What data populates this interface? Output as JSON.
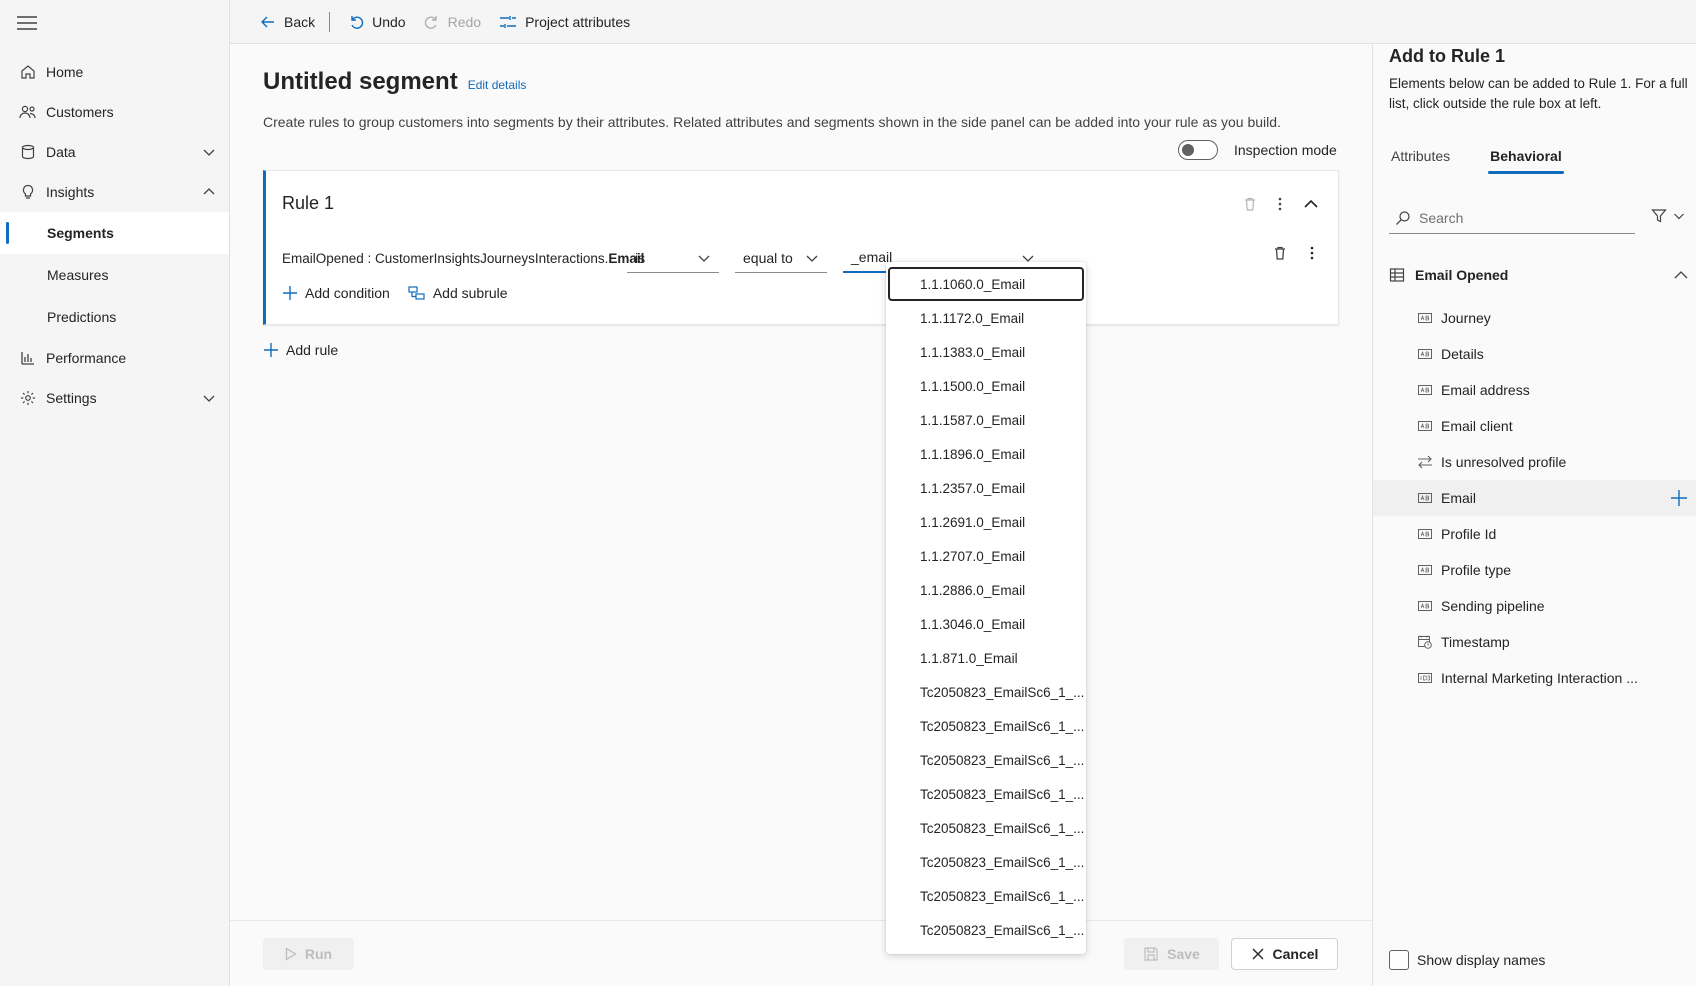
{
  "nav": {
    "items": [
      {
        "label": "Home"
      },
      {
        "label": "Customers"
      },
      {
        "label": "Data"
      },
      {
        "label": "Insights"
      },
      {
        "label": "Segments"
      },
      {
        "label": "Measures"
      },
      {
        "label": "Predictions"
      },
      {
        "label": "Performance"
      },
      {
        "label": "Settings"
      }
    ]
  },
  "toolbar": {
    "back": "Back",
    "undo": "Undo",
    "redo": "Redo",
    "project_attributes": "Project attributes"
  },
  "main": {
    "title": "Untitled segment",
    "edit_details": "Edit details",
    "description": "Create rules to group customers into segments by their attributes. Related attributes and segments shown in the side panel can be added into your rule as you build.",
    "inspection_mode": "Inspection mode",
    "rule": {
      "title": "Rule 1",
      "attribute_prefix": "EmailOpened : CustomerInsightsJourneysInteractions.",
      "attribute_field": "Email",
      "operator1": "is",
      "operator2": "equal to",
      "value": "_email",
      "add_condition": "Add condition",
      "add_subrule": "Add subrule"
    },
    "add_rule": "Add rule",
    "run": "Run",
    "save": "Save",
    "cancel": "Cancel"
  },
  "dropdown": {
    "options": [
      "1.1.1060.0_Email",
      "1.1.1172.0_Email",
      "1.1.1383.0_Email",
      "1.1.1500.0_Email",
      "1.1.1587.0_Email",
      "1.1.1896.0_Email",
      "1.1.2357.0_Email",
      "1.1.2691.0_Email",
      "1.1.2707.0_Email",
      "1.1.2886.0_Email",
      "1.1.3046.0_Email",
      "1.1.871.0_Email",
      "Tc2050823_EmailSc6_1_...",
      "Tc2050823_EmailSc6_1_...",
      "Tc2050823_EmailSc6_1_...",
      "Tc2050823_EmailSc6_1_...",
      "Tc2050823_EmailSc6_1_...",
      "Tc2050823_EmailSc6_1_...",
      "Tc2050823_EmailSc6_1_...",
      "Tc2050823_EmailSc6_1_..."
    ]
  },
  "panel": {
    "title": "Add to Rule 1",
    "description": "Elements below can be added to Rule 1. For a full list, click outside the rule box at left.",
    "tabs": [
      "Attributes",
      "Behavioral"
    ],
    "search_placeholder": "Search",
    "group": "Email Opened",
    "items": [
      {
        "label": "Journey",
        "icon": "text-field-icon"
      },
      {
        "label": "Details",
        "icon": "text-field-icon"
      },
      {
        "label": "Email address",
        "icon": "text-field-icon"
      },
      {
        "label": "Email client",
        "icon": "text-field-icon"
      },
      {
        "label": "Is unresolved profile",
        "icon": "boolean-arrows-icon"
      },
      {
        "label": "Email",
        "icon": "text-field-icon"
      },
      {
        "label": "Profile Id",
        "icon": "text-field-icon"
      },
      {
        "label": "Profile type",
        "icon": "text-field-icon"
      },
      {
        "label": "Sending pipeline",
        "icon": "text-field-icon"
      },
      {
        "label": "Timestamp",
        "icon": "calendar-clock-icon"
      },
      {
        "label": "Internal Marketing Interaction ...",
        "icon": "id-field-icon"
      }
    ],
    "show_display_names": "Show display names"
  },
  "colors": {
    "accent": "#0f6cbd",
    "nav_bg": "#f5f5f5"
  }
}
